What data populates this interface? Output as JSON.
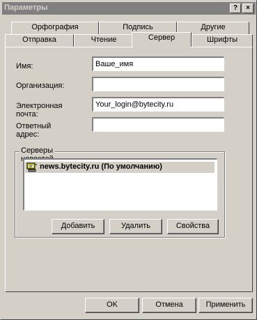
{
  "window": {
    "title": "Параметры"
  },
  "titlebar_buttons": {
    "help": "?",
    "close": "×"
  },
  "tabs": [
    {
      "label": "Орфография"
    },
    {
      "label": "Подпись"
    },
    {
      "label": "Другие"
    },
    {
      "label": "Отправка"
    },
    {
      "label": "Чтение"
    },
    {
      "label": "Сервер",
      "active": true
    },
    {
      "label": "Шрифты"
    }
  ],
  "form": {
    "name_label": "Имя:",
    "name_value": "Ваше_имя",
    "org_label": "Организация:",
    "org_value": "",
    "email_label": "Электронная почта:",
    "email_value": "Your_login@bytecity.ru",
    "reply_label": "Ответный адрес:",
    "reply_value": ""
  },
  "news_servers": {
    "group_label": "Серверы новостей",
    "items": [
      {
        "label": "news.bytecity.ru  (По умолчанию)",
        "selected": true
      }
    ],
    "add_label": "Добавить",
    "remove_label": "Удалить",
    "props_label": "Свойства"
  },
  "footer": {
    "ok_label": "OK",
    "cancel_label": "Отмена",
    "apply_label": "Применить"
  }
}
